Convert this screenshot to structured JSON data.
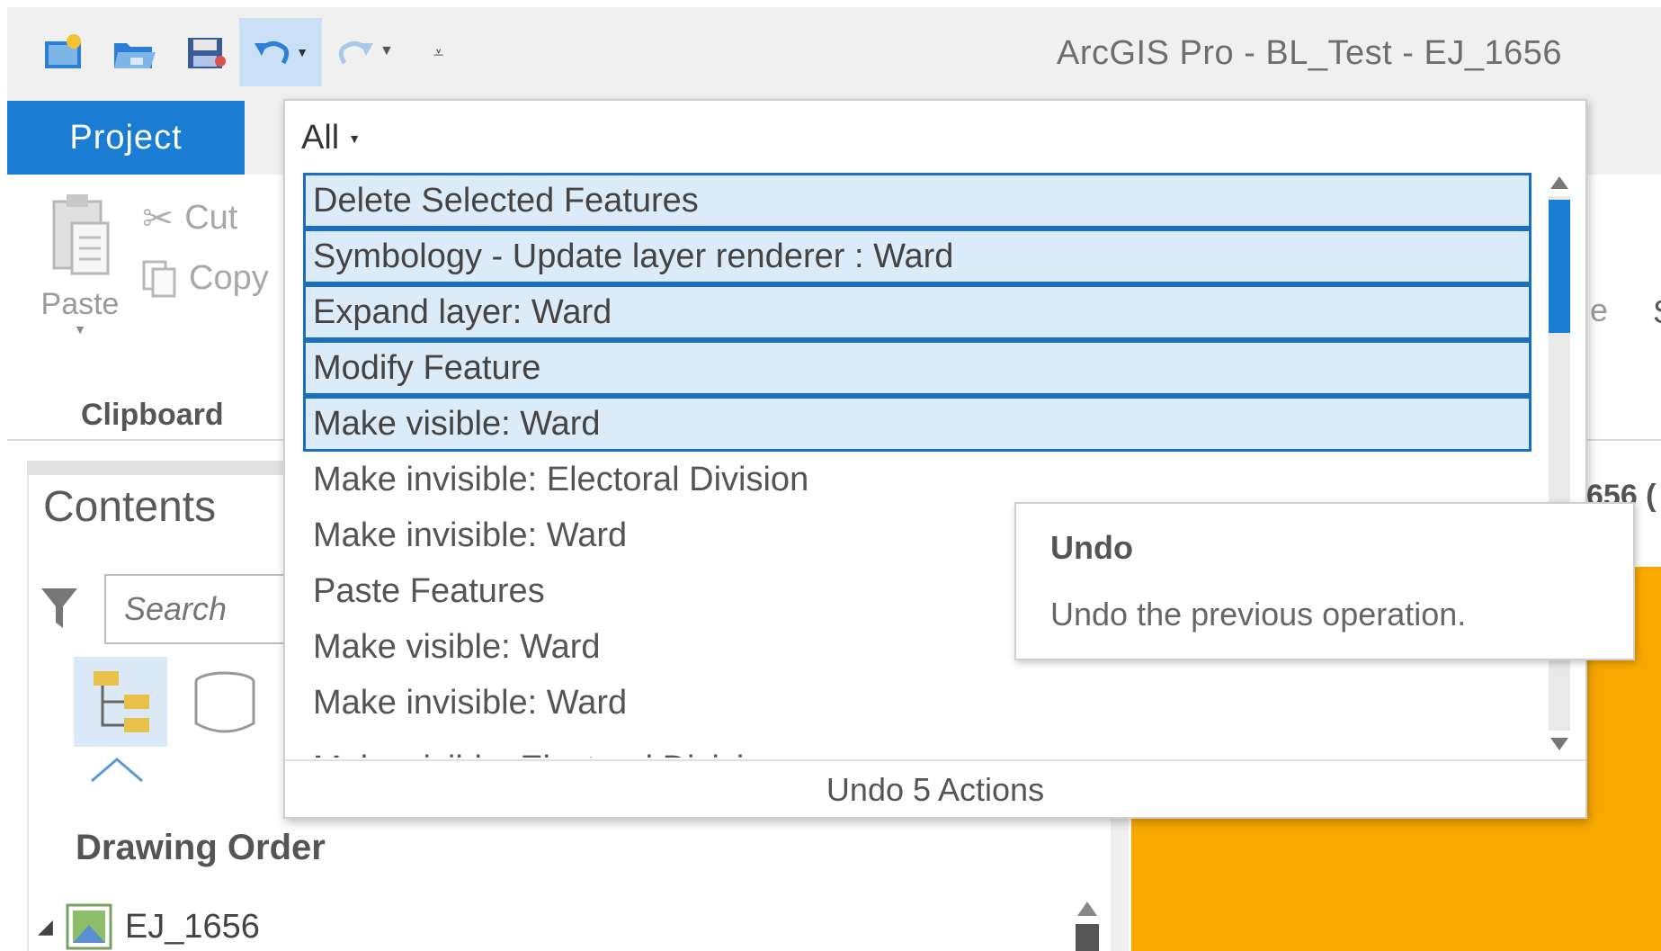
{
  "window": {
    "title": "ArcGIS Pro - BL_Test - EJ_1656"
  },
  "ribbon": {
    "project_tab": "Project",
    "paste_label": "Paste",
    "cut_label": "Cut",
    "copy_label": "Copy",
    "clipboard_group": "Clipboard",
    "right_fragment": "e",
    "right_fragment2": "S"
  },
  "undo_dropdown": {
    "filter_label": "All",
    "items": [
      {
        "label": "Delete Selected Features",
        "selected": true
      },
      {
        "label": "Symbology - Update layer renderer : Ward",
        "selected": true
      },
      {
        "label": "Expand layer: Ward",
        "selected": true
      },
      {
        "label": "Modify Feature",
        "selected": true
      },
      {
        "label": "Make visible: Ward",
        "selected": true
      },
      {
        "label": "Make invisible: Electoral Division",
        "selected": false
      },
      {
        "label": "Make invisible: Ward",
        "selected": false
      },
      {
        "label": "Paste Features",
        "selected": false
      },
      {
        "label": "Make visible: Ward",
        "selected": false
      },
      {
        "label": "Make invisible: Ward",
        "selected": false
      },
      {
        "label": "Make visible: Electoral Division",
        "selected": false
      }
    ],
    "footer": "Undo 5 Actions"
  },
  "tooltip": {
    "title": "Undo",
    "description": "Undo the previous operation."
  },
  "contents": {
    "title": "Contents",
    "search_placeholder": "Search",
    "drawing_order": "Drawing Order",
    "layer_name": "EJ_1656"
  },
  "map": {
    "tab_fragment": "656 ("
  },
  "colors": {
    "accent": "#1a7cd2",
    "selection_fill": "#dcebf8",
    "selection_border": "#1a6fc2",
    "map_fill": "#f9a800"
  }
}
